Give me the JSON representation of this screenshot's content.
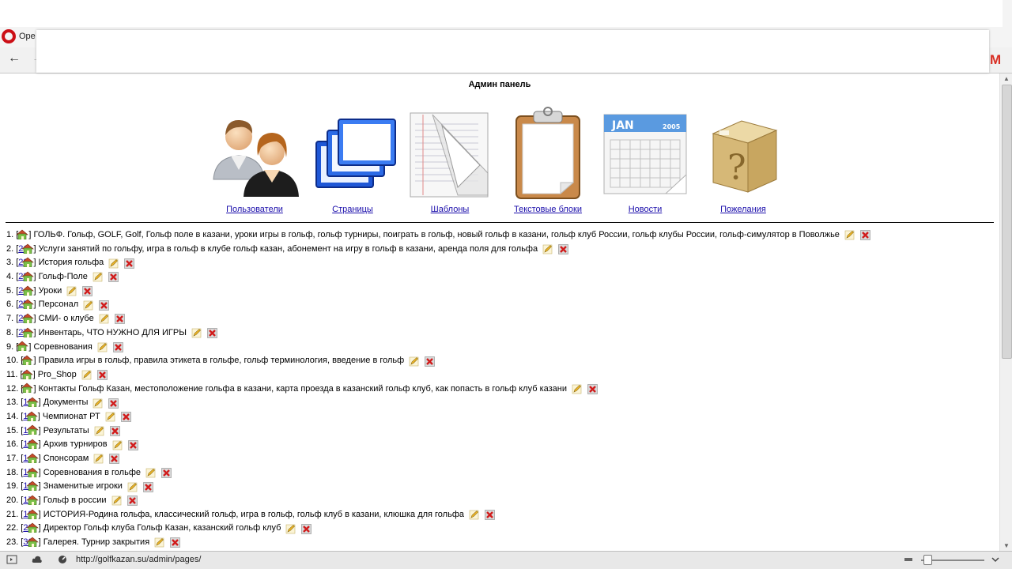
{
  "browser": {
    "tab_title": "Ope",
    "status_url": "http://golfkazan.su/admin/pages/"
  },
  "page": {
    "title": "Админ панель",
    "tiles": [
      {
        "label": "Пользователи",
        "icon": "users-icon"
      },
      {
        "label": "Страницы",
        "icon": "pages-icon"
      },
      {
        "label": "Шаблоны",
        "icon": "templates-icon"
      },
      {
        "label": "Текстовые блоки",
        "icon": "clipboard-icon"
      },
      {
        "label": "Новости",
        "icon": "calendar-icon",
        "calendar_month": "JAN",
        "calendar_year": "2005"
      },
      {
        "label": "Пожелания",
        "icon": "question-box-icon"
      }
    ],
    "pages": [
      {
        "num": "1.",
        "id": "1",
        "text": "ГОЛЬФ. Гольф, GOLF, Golf, Гольф поле в казани, уроки игры в гольф, гольф турниры, поиграть в гольф, новый гольф в казани, гольф клуб России, гольф клубы России, гольф-симулятор в Поволжье"
      },
      {
        "num": "2.",
        "id": "21",
        "text": "Услуги занятий по гольфу, игра в гольф в клубе гольф казан, абонемент на игру в гольф в казани, аренда поля для гольфа"
      },
      {
        "num": "3.",
        "id": "22",
        "text": "История гольфа"
      },
      {
        "num": "4.",
        "id": "23",
        "text": "Гольф-Поле"
      },
      {
        "num": "5.",
        "id": "24",
        "text": "Уроки"
      },
      {
        "num": "6.",
        "id": "25",
        "text": "Персонал"
      },
      {
        "num": "7.",
        "id": "26",
        "text": "СМИ- о клубе"
      },
      {
        "num": "8.",
        "id": "27",
        "text": "Инвентарь, ЧТО НУЖНО ДЛЯ ИГРЫ"
      },
      {
        "num": "9.",
        "id": "3",
        "text": "Соревнования"
      },
      {
        "num": "10.",
        "id": "5",
        "text": "Правила игры в гольф, правила этикета в гольфе, гольф терминология, введение в гольф"
      },
      {
        "num": "11.",
        "id": "6",
        "text": "Pro_Shop"
      },
      {
        "num": "12.",
        "id": "9",
        "text": "Контакты Гольф Казан, местоположение гольфа в казани, карта проезда в казанский гольф клуб, как попасть в гольф клуб казани"
      },
      {
        "num": "13.",
        "id": "10",
        "text": "Документы"
      },
      {
        "num": "14.",
        "id": "11",
        "text": "Чемпионат РТ"
      },
      {
        "num": "15.",
        "id": "12",
        "text": "Результаты"
      },
      {
        "num": "16.",
        "id": "13",
        "text": "Архив турниров"
      },
      {
        "num": "17.",
        "id": "14",
        "text": "Спонсорам"
      },
      {
        "num": "18.",
        "id": "15",
        "text": "Соревнования в гольфе"
      },
      {
        "num": "19.",
        "id": "16",
        "text": "Знаменитые игроки"
      },
      {
        "num": "20.",
        "id": "17",
        "text": "Гольф в россии"
      },
      {
        "num": "21.",
        "id": "18",
        "text": "ИСТОРИЯ-Родина гольфа, классический гольф, игра в гольф, гольф клуб в казани, клюшка для гольфа"
      },
      {
        "num": "22.",
        "id": "20",
        "text": "Директор Гольф клуба Гольф Казан, казанский гольф клуб"
      },
      {
        "num": "23.",
        "id": "30",
        "text": "Галерея. Турнир закрытия"
      }
    ]
  }
}
